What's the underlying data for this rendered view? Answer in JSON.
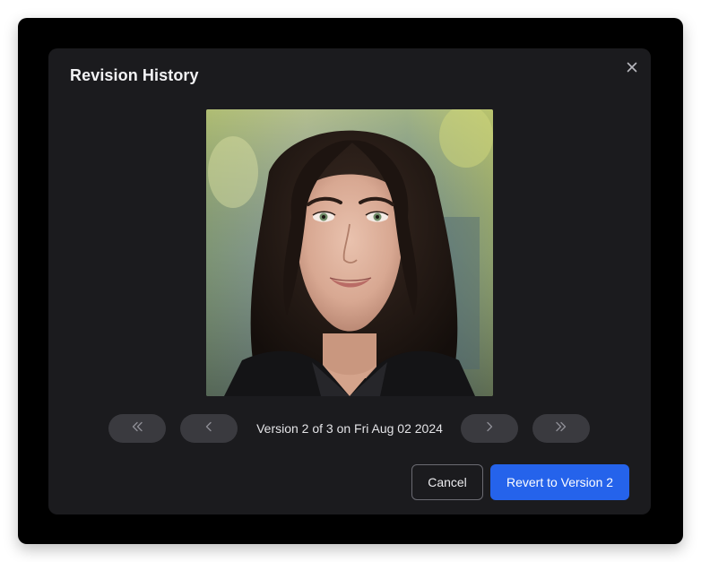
{
  "dialog": {
    "title": "Revision History",
    "close_icon": "close-icon"
  },
  "image": {
    "subject": "portrait-photo"
  },
  "navigation": {
    "first_icon": "double-chevron-left-icon",
    "prev_icon": "chevron-left-icon",
    "next_icon": "chevron-right-icon",
    "last_icon": "double-chevron-right-icon",
    "version_label": "Version 2 of 3 on Fri Aug 02 2024"
  },
  "actions": {
    "cancel_label": "Cancel",
    "revert_label": "Revert to Version 2"
  },
  "colors": {
    "dialog_bg": "#1b1b1e",
    "backdrop": "#000000",
    "nav_button": "#3a3a3f",
    "primary": "#2563eb"
  }
}
